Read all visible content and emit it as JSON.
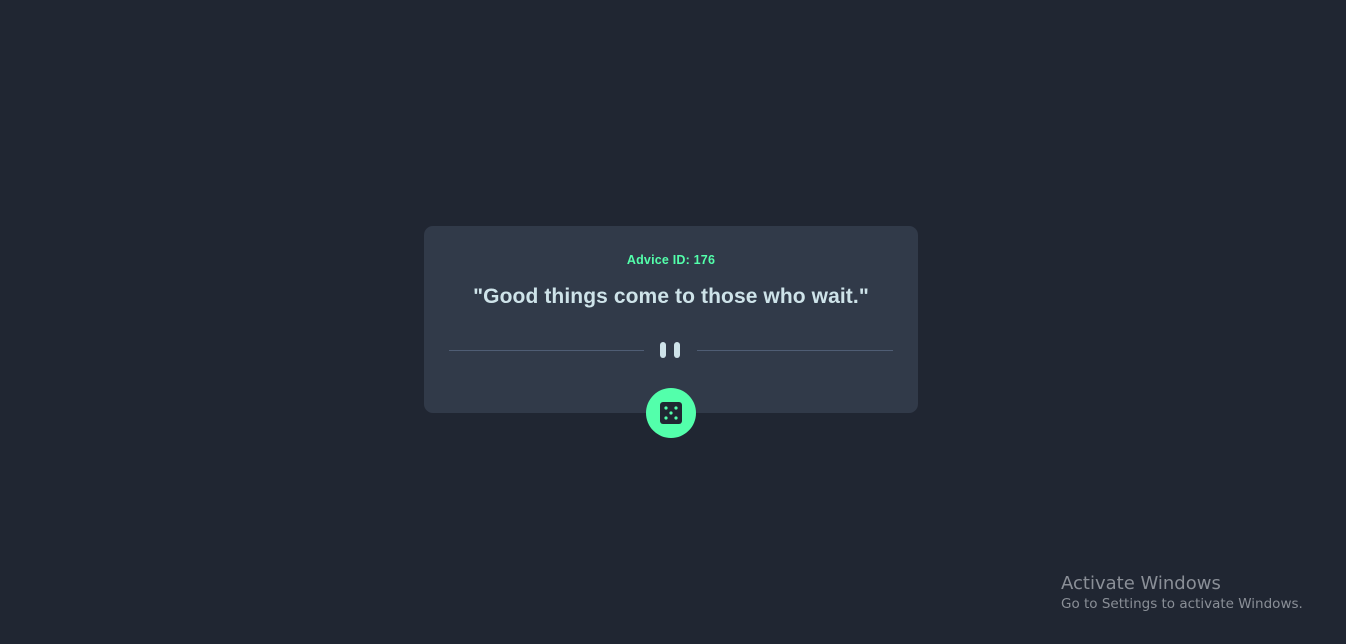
{
  "advice": {
    "id_label": "Advice ID: 176",
    "text": "\"Good things come to those who wait.\""
  },
  "button": {
    "icon": "dice-icon",
    "action": "get-new-advice"
  },
  "divider": {
    "icon": "pause-icon"
  },
  "watermark": {
    "title": "Activate Windows",
    "subtitle": "Go to Settings to activate Windows."
  },
  "colors": {
    "background": "#202632",
    "card": "#313a49",
    "accent": "#53ffab",
    "text": "#cee3e9",
    "divider": "#4f5d74"
  }
}
